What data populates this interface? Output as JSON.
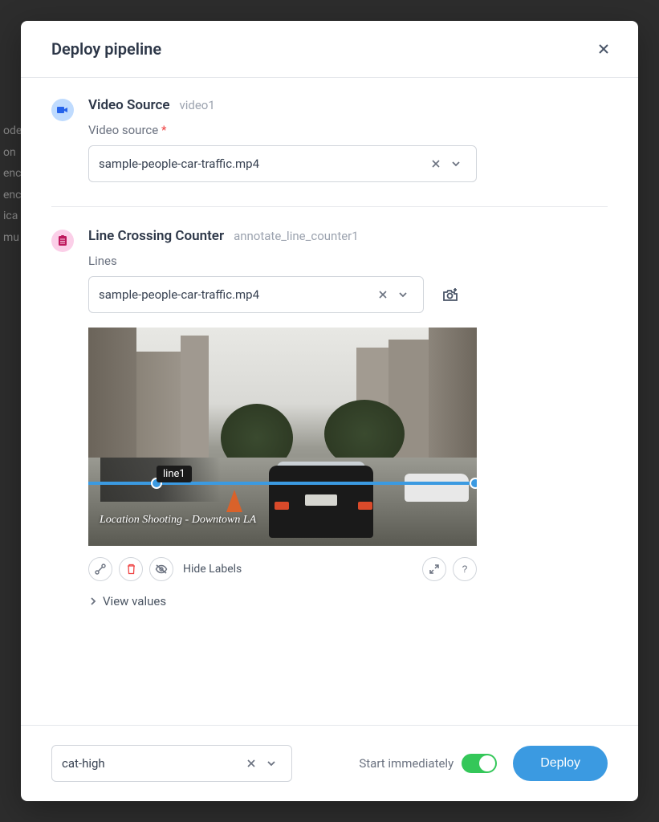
{
  "modal": {
    "title": "Deploy pipeline"
  },
  "section1": {
    "title": "Video Source",
    "id": "video1",
    "fieldLabel": "Video source",
    "required": "*",
    "selectValue": "sample-people-car-traffic.mp4"
  },
  "section2": {
    "title": "Line Crossing Counter",
    "id": "annotate_line_counter1",
    "fieldLabel": "Lines",
    "selectValue": "sample-people-car-traffic.mp4",
    "lineLabel": "line1",
    "watermark": "Location Shooting - Downtown LA",
    "hideLabels": "Hide Labels",
    "viewValues": "View values"
  },
  "footer": {
    "selectValue": "cat-high",
    "toggleLabel": "Start immediately",
    "deployLabel": "Deploy"
  },
  "background": {
    "lines": [
      "ode",
      "on",
      "enc",
      "enc",
      "ica",
      "mu"
    ]
  }
}
